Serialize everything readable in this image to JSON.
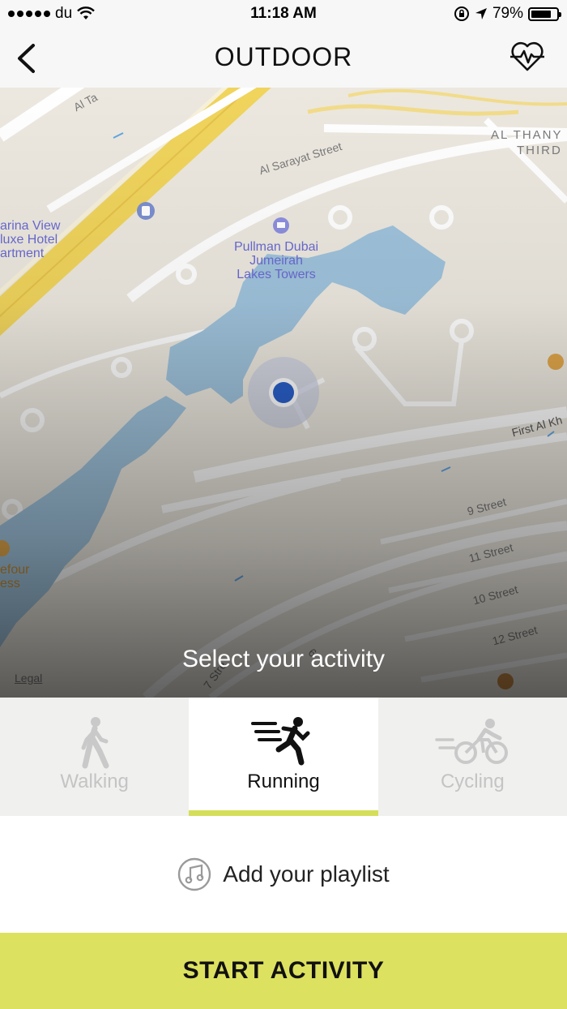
{
  "status_bar": {
    "carrier": "du",
    "time": "11:18 AM",
    "battery": "79%",
    "battery_level": 0.79
  },
  "nav": {
    "title": "OUTDOOR",
    "back_icon": "chevron-left-icon",
    "right_icon": "heart-pulse-icon"
  },
  "map": {
    "labels": {
      "al_sarayat": "Al Sarayat Street",
      "al_thany": "AL THANY",
      "third": "THIRD",
      "al_ta": "Al Ta",
      "first_al": "First Al Kh",
      "street9": "9 Street",
      "street11": "11 Street",
      "street10": "10 Street",
      "street12": "12 Street",
      "street6": "6",
      "street7": "7 Stre"
    },
    "poi_hotel": [
      "Pullman Dubai",
      "Jumeirah",
      "Lakes Towers"
    ],
    "poi_marina": [
      "arina View",
      "luxe Hotel",
      "artment"
    ],
    "poi_carrefour": [
      "efour",
      "ess"
    ],
    "legal": "Legal",
    "prompt": "Select your activity"
  },
  "activities": [
    {
      "label": "Walking",
      "icon": "walking-icon",
      "active": false
    },
    {
      "label": "Running",
      "icon": "running-icon",
      "active": true
    },
    {
      "label": "Cycling",
      "icon": "cycling-icon",
      "active": false
    }
  ],
  "playlist": {
    "label": "Add your playlist",
    "icon": "music-note-icon"
  },
  "start": {
    "label": "START ACTIVITY"
  },
  "colors": {
    "accent": "#dde160",
    "underline": "#d5de5a",
    "location": "#2a5fc9",
    "water": "#9fc3dc"
  }
}
